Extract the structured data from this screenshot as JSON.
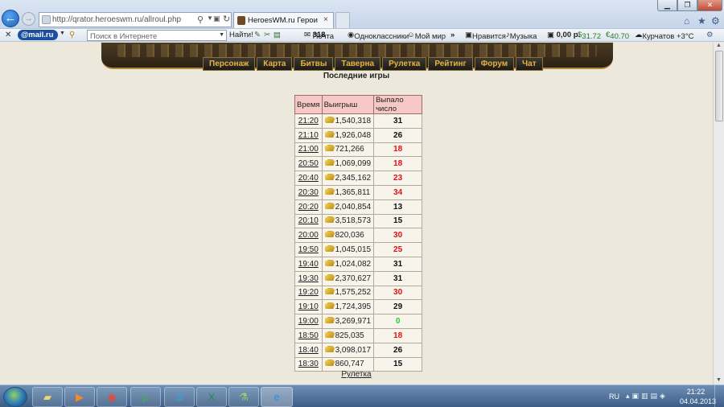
{
  "browser": {
    "url": "http://qrator.heroeswm.ru/allroul.php",
    "tab_title": "HeroesWM.ru Герои войн...",
    "tab_close": "×",
    "back": "←",
    "forward": "→",
    "window_min": "▁",
    "window_max": "❐",
    "window_close": "✕",
    "home": "⌂",
    "star": "★",
    "gear": "⚙"
  },
  "toolbar": {
    "close": "✕",
    "mailru_logo": "@mail.ru",
    "search_placeholder": "Поиск в Интернете",
    "find_label": "Найти!",
    "mail_label": "Почта",
    "mail_count": "318",
    "ok_label": "Одноклассники",
    "myworld_label": "Мой мир",
    "more": "»",
    "like_label": "Нравится",
    "music_label": "Музыка",
    "money": "0,00 р.",
    "usd": "31.72",
    "eur": "40.70",
    "weather": "Курчатов +3°С"
  },
  "nav": {
    "items": [
      {
        "label": "Персонаж"
      },
      {
        "label": "Карта"
      },
      {
        "label": "Битвы"
      },
      {
        "label": "Таверна"
      },
      {
        "label": "Рулетка"
      },
      {
        "label": "Рейтинг"
      },
      {
        "label": "Форум"
      },
      {
        "label": "Чат"
      }
    ]
  },
  "main": {
    "title": "Последние игры",
    "columns": {
      "time": "Время",
      "win": "Выигрыш",
      "number": "Выпало число"
    },
    "rows": [
      {
        "time": "21:20",
        "win": "1,540,318",
        "number": "31",
        "color": "black"
      },
      {
        "time": "21:10",
        "win": "1,926,048",
        "number": "26",
        "color": "black"
      },
      {
        "time": "21:00",
        "win": "721,266",
        "number": "18",
        "color": "red"
      },
      {
        "time": "20:50",
        "win": "1,069,099",
        "number": "18",
        "color": "red"
      },
      {
        "time": "20:40",
        "win": "2,345,162",
        "number": "23",
        "color": "red"
      },
      {
        "time": "20:30",
        "win": "1,365,811",
        "number": "34",
        "color": "red"
      },
      {
        "time": "20:20",
        "win": "2,040,854",
        "number": "13",
        "color": "black"
      },
      {
        "time": "20:10",
        "win": "3,518,573",
        "number": "15",
        "color": "black"
      },
      {
        "time": "20:00",
        "win": "820,036",
        "number": "30",
        "color": "red"
      },
      {
        "time": "19:50",
        "win": "1,045,015",
        "number": "25",
        "color": "red"
      },
      {
        "time": "19:40",
        "win": "1,024,082",
        "number": "31",
        "color": "black"
      },
      {
        "time": "19:30",
        "win": "2,370,627",
        "number": "31",
        "color": "black"
      },
      {
        "time": "19:20",
        "win": "1,575,252",
        "number": "30",
        "color": "red"
      },
      {
        "time": "19:10",
        "win": "1,724,395",
        "number": "29",
        "color": "black"
      },
      {
        "time": "19:00",
        "win": "3,269,971",
        "number": "0",
        "color": "green"
      },
      {
        "time": "18:50",
        "win": "825,035",
        "number": "18",
        "color": "red"
      },
      {
        "time": "18:40",
        "win": "3,098,017",
        "number": "26",
        "color": "black"
      },
      {
        "time": "18:30",
        "win": "860,747",
        "number": "15",
        "color": "black"
      }
    ],
    "footer_link": "Рулетка"
  },
  "taskbar": {
    "lang": "RU",
    "clock_time": "21:22",
    "clock_date": "04.04.2013"
  },
  "colors": {
    "page_bg": "#ece8dc",
    "header_bg": "#f6c9c6",
    "red": "#e01010",
    "green": "#28d228",
    "nav_text": "#e9b43c"
  }
}
